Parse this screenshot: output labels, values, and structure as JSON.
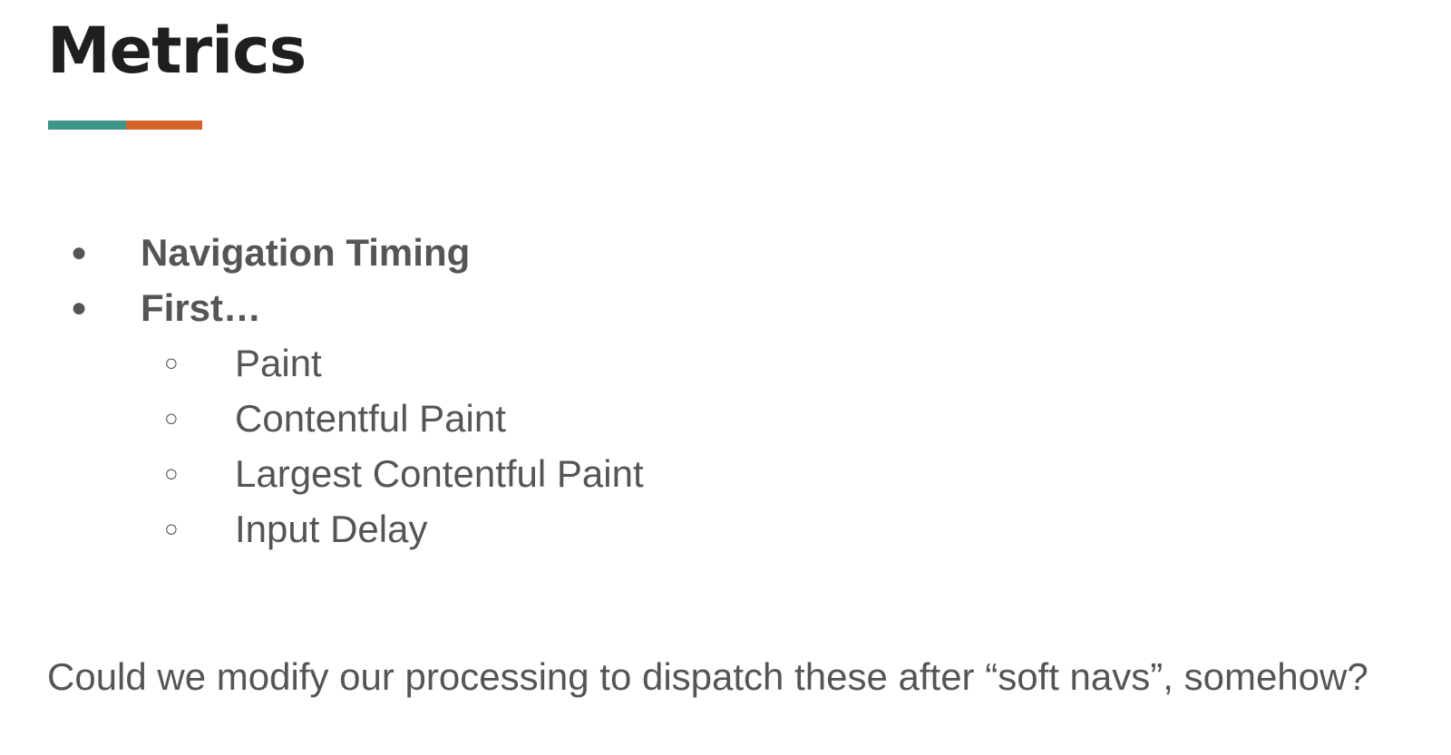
{
  "slide": {
    "title": "Metrics",
    "accent_colors": [
      "#3e9688",
      "#d4622a"
    ],
    "items": [
      {
        "label": "Navigation Timing",
        "bullet": "●",
        "level": 1
      },
      {
        "label": "First…",
        "bullet": "●",
        "level": 1
      },
      {
        "label": "Paint",
        "bullet": "○",
        "level": 2
      },
      {
        "label": "Contentful Paint",
        "bullet": "○",
        "level": 2
      },
      {
        "label": "Largest Contentful Paint",
        "bullet": "○",
        "level": 2
      },
      {
        "label": "Input Delay",
        "bullet": "○",
        "level": 2
      }
    ],
    "question": "Could we modify our processing to dispatch these after “soft navs”, somehow?"
  }
}
